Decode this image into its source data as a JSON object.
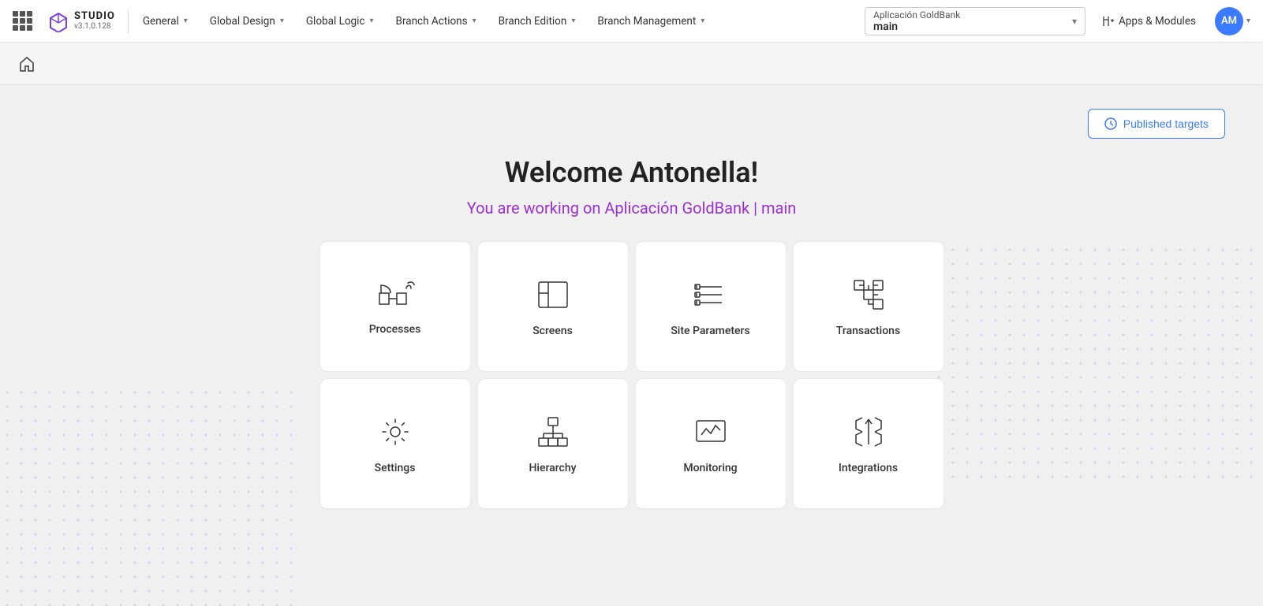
{
  "nav": {
    "logo": {
      "studio": "STUDIO",
      "version": "v3.1.0.128"
    },
    "menu_items": [
      {
        "id": "general",
        "label": "General",
        "has_dropdown": true
      },
      {
        "id": "global_design",
        "label": "Global Design",
        "has_dropdown": true
      },
      {
        "id": "global_logic",
        "label": "Global Logic",
        "has_dropdown": true
      },
      {
        "id": "branch_actions",
        "label": "Branch Actions",
        "has_dropdown": true
      },
      {
        "id": "branch_edition",
        "label": "Branch Edition",
        "has_dropdown": true
      },
      {
        "id": "branch_management",
        "label": "Branch Management",
        "has_dropdown": true
      }
    ],
    "app_selector": {
      "app_name": "Aplicación GoldBank",
      "branch": "main"
    },
    "apps_modules_label": "Apps & Modules",
    "avatar_initials": "AM"
  },
  "secondary_bar": {
    "home_tooltip": "Home"
  },
  "main": {
    "published_targets_label": "Published targets",
    "welcome_title": "Welcome Antonella!",
    "welcome_subtitle": "You are working on Aplicación GoldBank | main",
    "cards": [
      {
        "id": "processes",
        "label": "Processes"
      },
      {
        "id": "screens",
        "label": "Screens"
      },
      {
        "id": "site_parameters",
        "label": "Site Parameters"
      },
      {
        "id": "transactions",
        "label": "Transactions"
      },
      {
        "id": "settings",
        "label": "Settings"
      },
      {
        "id": "hierarchy",
        "label": "Hierarchy"
      },
      {
        "id": "monitoring",
        "label": "Monitoring"
      },
      {
        "id": "integrations",
        "label": "Integrations"
      }
    ]
  },
  "colors": {
    "accent_blue": "#3a7afe",
    "accent_purple": "#9b30d0",
    "nav_bg": "#ffffff",
    "body_bg": "#f0f0f0"
  }
}
